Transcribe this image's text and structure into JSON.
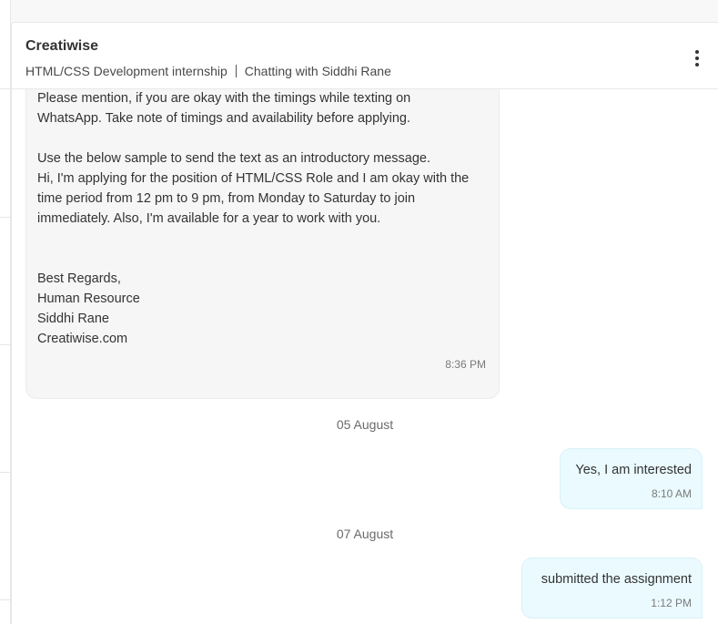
{
  "header": {
    "company": "Creatiwise",
    "internship": "HTML/CSS Development internship",
    "chatting_with": "Chatting with Siddhi Rane"
  },
  "messages": {
    "incoming": {
      "lines": [
        "Please mention, if you are okay with the timings while texting on",
        "WhatsApp. Take note of timings and availability before applying.",
        "Use the below sample to send the text as an introductory message.",
        "Hi, I'm applying for the position of HTML/CSS Role and I am okay with the",
        "time period from 12 pm to 9 pm, from Monday to Saturday to join",
        "immediately. Also, I'm available for a year to work with you.",
        "Best Regards,",
        "Human Resource",
        "Siddhi Rane",
        "Creatiwise.com"
      ],
      "time": "8:36 PM"
    },
    "date_1": "05 August",
    "reply_1": {
      "text": "Yes, I am interested",
      "time": "8:10 AM"
    },
    "date_2": "07 August",
    "reply_2": {
      "text": "submitted the assignment",
      "time": "1:12 PM"
    }
  },
  "colors": {
    "incoming_bubble": "#f6f6f6",
    "outgoing_bubble": "#eafafe"
  },
  "icons": {
    "more": "more-vertical-icon"
  }
}
